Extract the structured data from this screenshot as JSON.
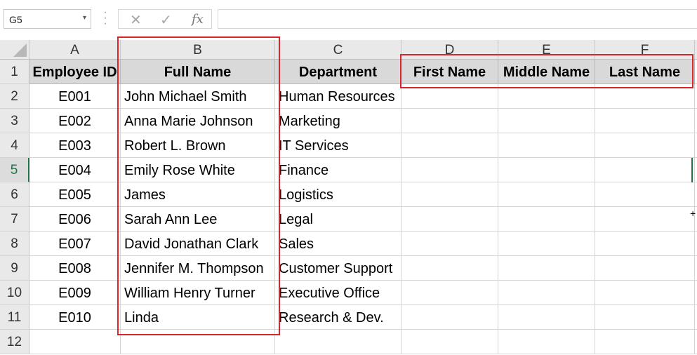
{
  "formula_bar": {
    "name_box": "G5",
    "name_box_arrow": "▾",
    "cancel_icon": "✕",
    "enter_icon": "✓",
    "fx_label": "fx",
    "formula": ""
  },
  "columns": [
    "A",
    "B",
    "C",
    "D",
    "E",
    "F"
  ],
  "rows": [
    "1",
    "2",
    "3",
    "4",
    "5",
    "6",
    "7",
    "8",
    "9",
    "10",
    "11",
    "12"
  ],
  "active_row": "5",
  "headers": [
    "Employee ID",
    "Full Name",
    "Department",
    "First Name",
    "Middle Name",
    "Last Name"
  ],
  "data": [
    [
      "E001",
      "John Michael Smith",
      "Human Resources"
    ],
    [
      "E002",
      "Anna Marie Johnson",
      "Marketing"
    ],
    [
      "E003",
      "Robert L. Brown",
      "IT Services"
    ],
    [
      "E004",
      "Emily Rose White",
      "Finance"
    ],
    [
      "E005",
      "James",
      "Logistics"
    ],
    [
      "E006",
      "Sarah Ann Lee",
      "Legal"
    ],
    [
      "E007",
      "David Jonathan Clark",
      "Sales"
    ],
    [
      "E008",
      "Jennifer M. Thompson",
      "Customer Support"
    ],
    [
      "E009",
      "William Henry Turner",
      "Executive Office"
    ],
    [
      "E010",
      "Linda",
      "Research & Dev."
    ]
  ],
  "highlight_color": "#d9262c",
  "accent_color": "#217346"
}
